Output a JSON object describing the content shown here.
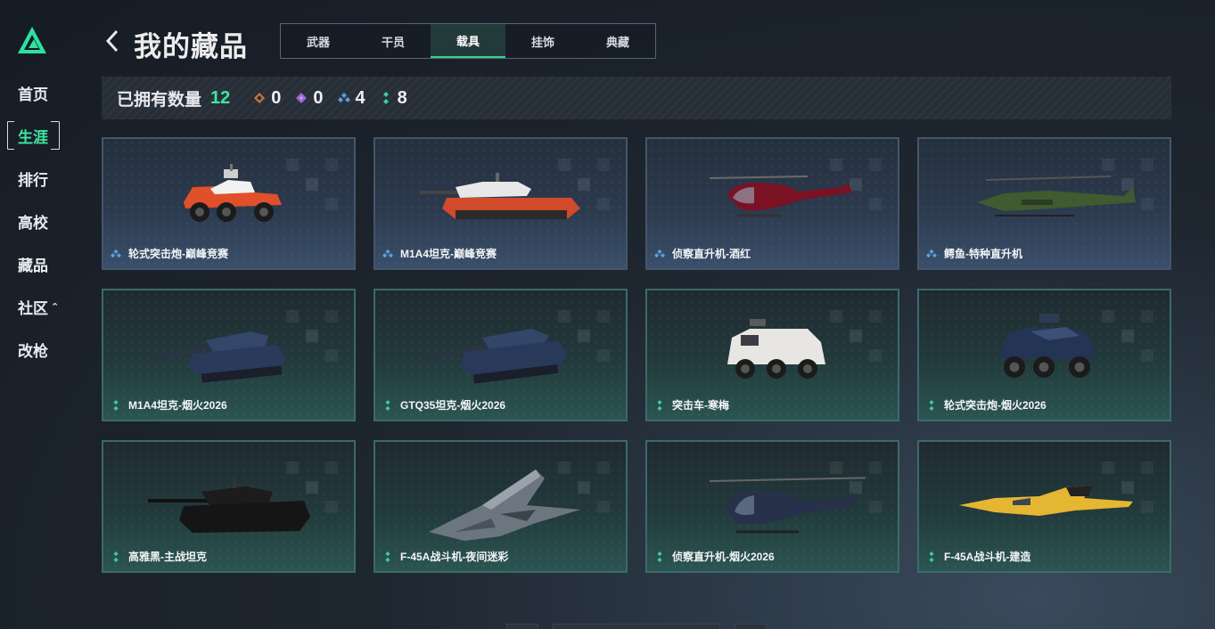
{
  "nav": {
    "items": [
      {
        "label": "首页",
        "active": false
      },
      {
        "label": "生涯",
        "active": true
      },
      {
        "label": "排行",
        "active": false
      },
      {
        "label": "高校",
        "active": false
      },
      {
        "label": "藏品",
        "active": false
      },
      {
        "label": "社区",
        "active": false,
        "caret": "^"
      },
      {
        "label": "改枪",
        "active": false
      }
    ]
  },
  "header": {
    "title": "我的藏品",
    "tabs": [
      {
        "label": "武器",
        "active": false
      },
      {
        "label": "干员",
        "active": false
      },
      {
        "label": "载具",
        "active": true
      },
      {
        "label": "挂饰",
        "active": false
      },
      {
        "label": "典藏",
        "active": false
      }
    ]
  },
  "summary": {
    "label": "已拥有数量",
    "total": "12",
    "rarities": [
      {
        "icon": "orange-diamond-icon",
        "color": "#c9773a",
        "count": "0"
      },
      {
        "icon": "purple-diamond-icon",
        "color": "#9a6ad8",
        "count": "0"
      },
      {
        "icon": "blue-triple-diamond-icon",
        "color": "#5b9ee0",
        "count": "4"
      },
      {
        "icon": "green-double-diamond-icon",
        "color": "#3ecf98",
        "count": "8"
      }
    ]
  },
  "items": [
    {
      "name": "轮式突击炮-巅峰竞赛",
      "rarity": "blue",
      "kind": "wheeled-red"
    },
    {
      "name": "M1A4坦克-巅峰竞赛",
      "rarity": "blue",
      "kind": "tank-red"
    },
    {
      "name": "侦察直升机-酒红",
      "rarity": "blue",
      "kind": "heli-red"
    },
    {
      "name": "鳄鱼-特种直升机",
      "rarity": "blue",
      "kind": "apache"
    },
    {
      "name": "M1A4坦克-烟火2026",
      "rarity": "green",
      "kind": "tank-navy"
    },
    {
      "name": "GTQ35坦克-烟火2026",
      "rarity": "green",
      "kind": "tank-navy2"
    },
    {
      "name": "突击车-寒梅",
      "rarity": "green",
      "kind": "truck-white"
    },
    {
      "name": "轮式突击炮-烟火2026",
      "rarity": "green",
      "kind": "wheeled-navy"
    },
    {
      "name": "高雅黑-主战坦克",
      "rarity": "green",
      "kind": "tank-black"
    },
    {
      "name": "F-45A战斗机-夜间迷彩",
      "rarity": "green",
      "kind": "jet-camo"
    },
    {
      "name": "侦察直升机-烟火2026",
      "rarity": "green",
      "kind": "heli-navy"
    },
    {
      "name": "F-45A战斗机-建造",
      "rarity": "green",
      "kind": "jet-yellow"
    }
  ]
}
